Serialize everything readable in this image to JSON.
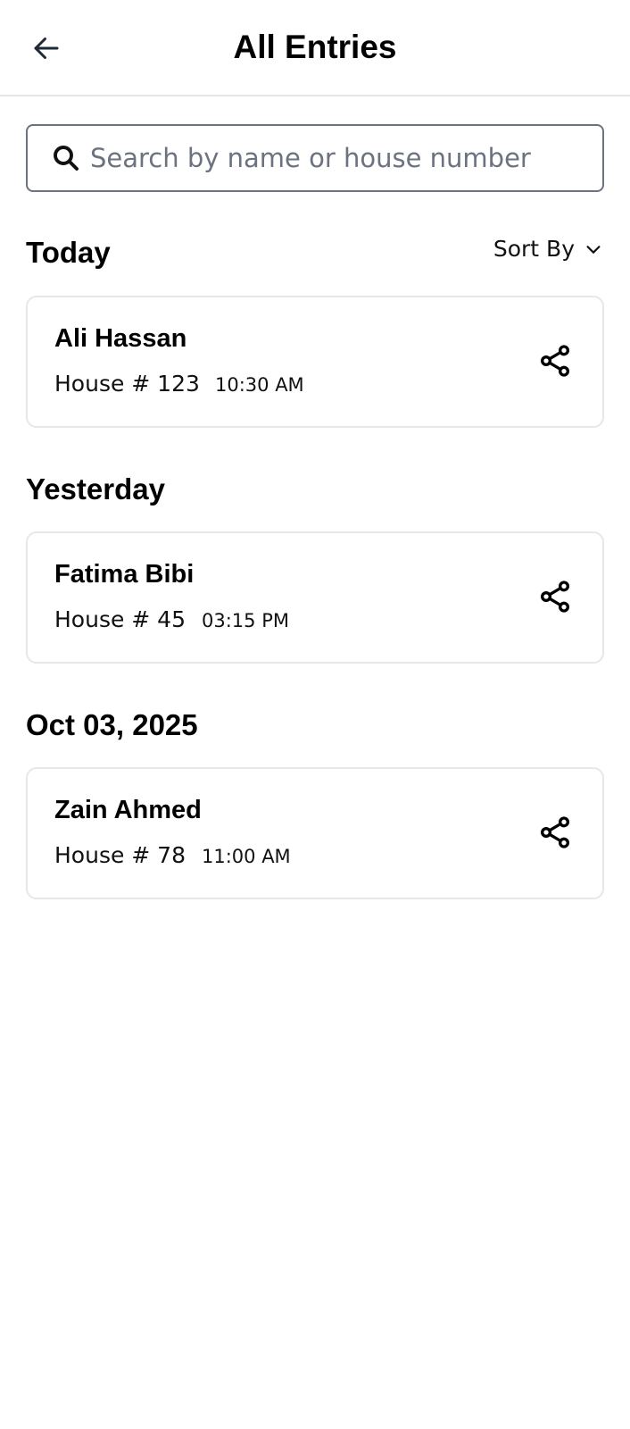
{
  "header": {
    "title": "All Entries",
    "back_icon": "arrow-left-icon"
  },
  "search": {
    "placeholder": "Search by name or house number",
    "value": "",
    "icon": "search-icon"
  },
  "sort": {
    "label": "Sort By",
    "icon": "chevron-down-icon"
  },
  "sections": [
    {
      "title": "Today",
      "entries": [
        {
          "name": "Ali Hassan",
          "house": "House # 123",
          "time": "10:30 AM",
          "icon": "share-icon"
        }
      ]
    },
    {
      "title": "Yesterday",
      "entries": [
        {
          "name": "Fatima Bibi",
          "house": "House # 45",
          "time": "03:15 PM",
          "icon": "share-icon"
        }
      ]
    },
    {
      "title": "Oct 03, 2025",
      "entries": [
        {
          "name": "Zain Ahmed",
          "house": "House # 78",
          "time": "11:00 AM",
          "icon": "share-icon"
        }
      ]
    }
  ],
  "colors": {
    "border_input": "#6b7280",
    "border_card": "#e5e7eb",
    "header_divider": "#e6e6e6",
    "placeholder": "#6b7280"
  }
}
